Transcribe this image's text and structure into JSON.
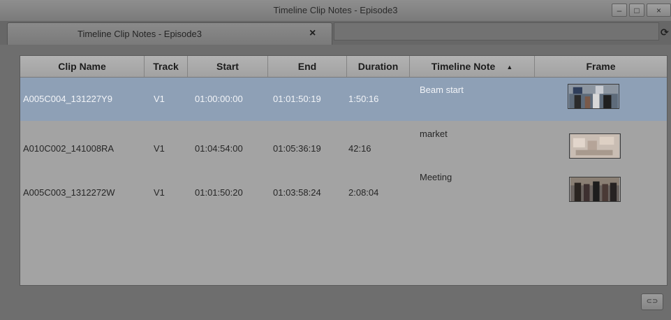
{
  "window": {
    "title": "Timeline Clip Notes - Episode3",
    "minimize_icon": "minimize-icon",
    "maximize_icon": "maximize-icon",
    "close_icon": "close-icon"
  },
  "tab": {
    "label": "Timeline Clip Notes - Episode3",
    "close_glyph": "×"
  },
  "table": {
    "columns": [
      "Clip Name",
      "Track",
      "Start",
      "End",
      "Duration",
      "Timeline Note",
      "Frame"
    ],
    "sorted_column": "Timeline Note",
    "sort_direction": "ascending",
    "rows": [
      {
        "clip_name": "A005C004_131227Y9",
        "track": "V1",
        "start": "01:00:00:00",
        "end": "01:01:50:19",
        "duration": "1:50:16",
        "note": "Beam start",
        "selected": true
      },
      {
        "clip_name": "A010C002_141008RA",
        "track": "V1",
        "start": "01:04:54:00",
        "end": "01:05:36:19",
        "duration": "42:16",
        "note": "market",
        "selected": false
      },
      {
        "clip_name": "A005C003_1312272W",
        "track": "V1",
        "start": "01:01:50:20",
        "end": "01:03:58:24",
        "duration": "2:08:04",
        "note": "Meeting",
        "selected": false
      }
    ]
  },
  "colors": {
    "selection": "#8ea0b6",
    "panel": "#a3a3a3",
    "background": "#6e6e6e"
  }
}
